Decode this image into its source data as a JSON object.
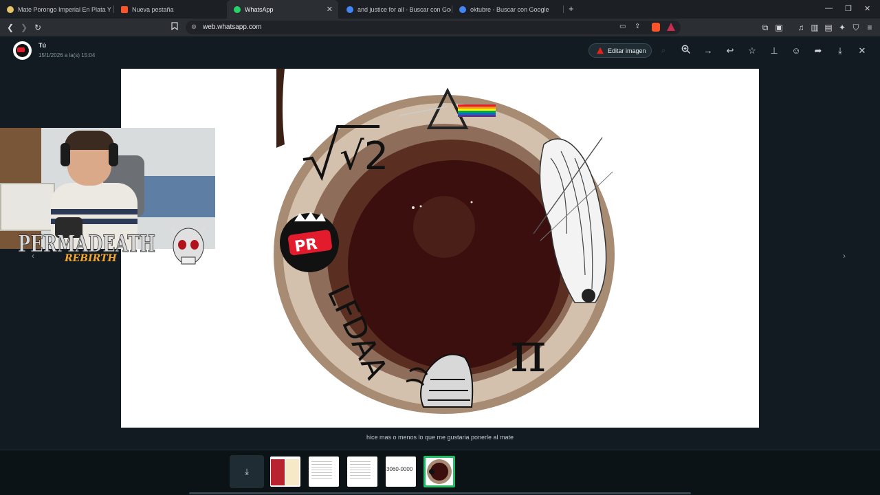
{
  "browser": {
    "tabs": [
      {
        "title": "Mate Porongo Imperial En Plata Y De",
        "active": false,
        "favicon_color": "#e7c36a"
      },
      {
        "title": "Nueva pestaña",
        "active": false,
        "favicon_color": "#fb542b"
      },
      {
        "title": "WhatsApp",
        "active": true,
        "favicon_color": "#25d366"
      },
      {
        "title": "and justice for all - Buscar con Googl",
        "active": false,
        "favicon_color": "#4285f4"
      },
      {
        "title": "oktubre - Buscar con Google",
        "active": false,
        "favicon_color": "#4285f4"
      }
    ],
    "url": "web.whatsapp.com"
  },
  "viewer": {
    "sender": "Tú",
    "timestamp": "15/1/2026 a la(s) 15:04",
    "edit_button_label": "Editar imagen",
    "actions": [
      "zoom-in-icon",
      "forward-arrow-icon",
      "reply-icon",
      "star-icon",
      "pin-icon",
      "emoji-icon",
      "share-icon",
      "download-icon",
      "close-icon"
    ],
    "caption": "hice mas o menos lo que me gustaria ponerle al mate"
  },
  "image": {
    "sqrt_text": "√2",
    "pr_text": "PR",
    "lfdaa_text": "LFDAA",
    "pi_text": "π"
  },
  "webcam": {
    "logo_text": "PERMADEATH",
    "logo_sub": "REBIRTH"
  },
  "thumbnails": [
    {
      "kind": "spreadsheet",
      "selected": false
    },
    {
      "kind": "document",
      "selected": false
    },
    {
      "kind": "document",
      "selected": false
    },
    {
      "kind": "text",
      "text": "3060-0000",
      "selected": false
    },
    {
      "kind": "mate",
      "selected": true
    }
  ],
  "colors": {
    "whatsapp_green": "#1fbe67",
    "background": "#111b21",
    "pr_red": "#e21b2d"
  }
}
